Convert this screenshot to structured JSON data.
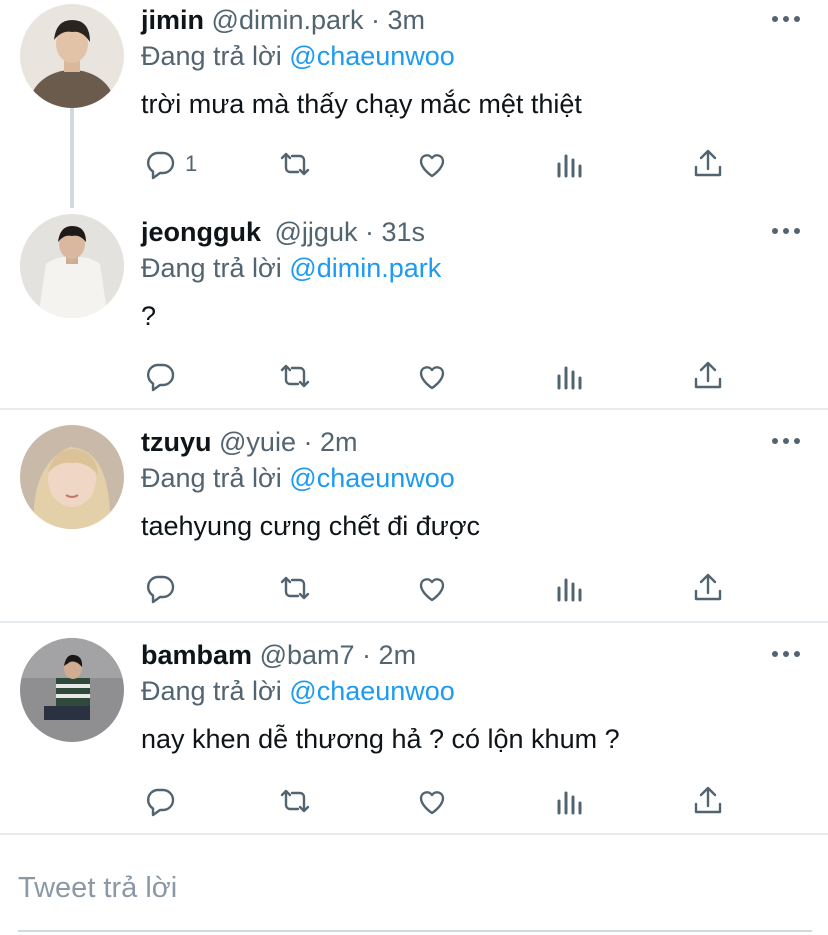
{
  "tweets": [
    {
      "name": "jimin",
      "handle": "@dimin.park",
      "sep": "·",
      "time": "3m",
      "reply_prefix": "Đang trả lời",
      "reply_to": "@chaeunwoo",
      "text": "trời mưa mà thấy chạy mắc mệt thiệt",
      "reply_count": "1"
    },
    {
      "name": "jeongguk",
      "handle": "@jjguk",
      "sep": "·",
      "time": "31s",
      "reply_prefix": "Đang trả lời",
      "reply_to": "@dimin.park",
      "text": "?",
      "reply_count": ""
    },
    {
      "name": "tzuyu",
      "handle": "@yuie",
      "sep": "·",
      "time": "2m",
      "reply_prefix": "Đang trả lời",
      "reply_to": "@chaeunwoo",
      "text": "taehyung cưng chết đi được",
      "reply_count": ""
    },
    {
      "name": "bambam",
      "handle": "@bam7",
      "sep": "·",
      "time": "2m",
      "reply_prefix": "Đang trả lời",
      "reply_to": "@chaeunwoo",
      "text": "nay khen dễ thương hả ? có lộn khum ?",
      "reply_count": ""
    }
  ],
  "icons": {
    "reply": "reply-icon",
    "retweet": "retweet-icon",
    "like": "heart-icon",
    "views": "analytics-icon",
    "share": "share-icon",
    "more": "more-icon"
  },
  "composer": {
    "placeholder": "Tweet trả lời"
  },
  "colors": {
    "link": "#1d9bf0",
    "muted": "#536471",
    "icon": "#536471",
    "divider": "#e6ecf0"
  }
}
